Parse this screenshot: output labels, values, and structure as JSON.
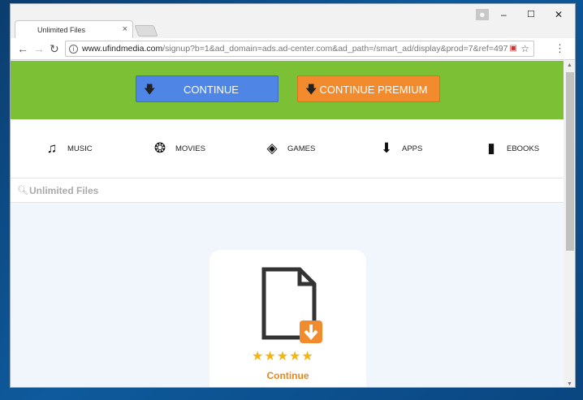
{
  "browser": {
    "tab_title": "Unlimited Files",
    "tab_close": "×",
    "url_host": "www.ufindmedia.com",
    "url_path": "/signup?b=1&ad_domain=ads.ad-center.com&ad_path=/smart_ad/display&prod=7&ref=497",
    "window_buttons": [
      "–",
      "☐",
      "✕"
    ]
  },
  "banner": {
    "continue_label": "CONTINUE",
    "premium_label": "CONTINUE PREMIUM",
    "color_blue": "#4f86e6",
    "color_orange": "#f28a2e",
    "color_green": "#7cc036"
  },
  "categories": [
    {
      "label": "MUSIC",
      "icon": "music-icon"
    },
    {
      "label": "MOVIES",
      "icon": "film-reel-icon"
    },
    {
      "label": "GAMES",
      "icon": "gamepad-icon"
    },
    {
      "label": "APPS",
      "icon": "download-tray-icon"
    },
    {
      "label": "EBOOKS",
      "icon": "book-icon"
    }
  ],
  "search": {
    "text": "Unlimited Files"
  },
  "card": {
    "stars": "★★★★★",
    "rating": 5,
    "continue_label": "Continue",
    "accent": "#e6871f"
  }
}
